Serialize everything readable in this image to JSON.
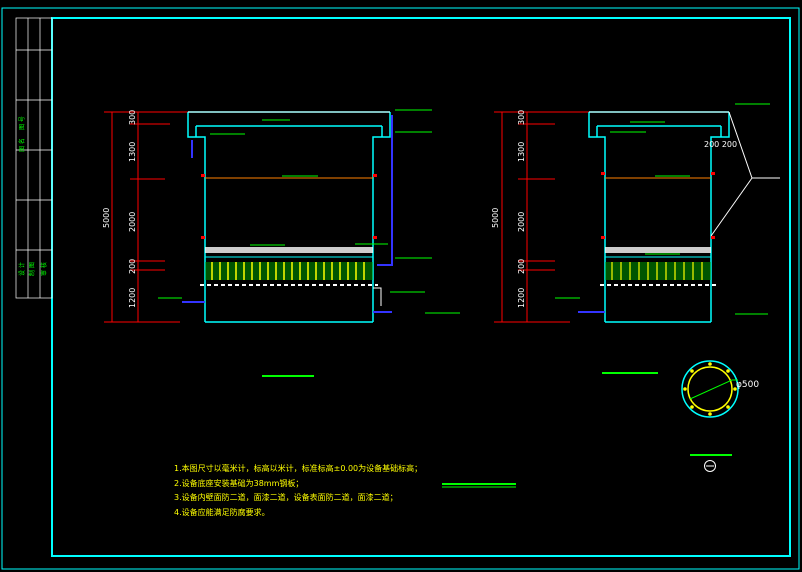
{
  "drawing": {
    "left_elevation": {
      "dims": [
        "300",
        "1300",
        "2000",
        "200",
        "1200"
      ],
      "total": "5000"
    },
    "right_elevation": {
      "dims": [
        "300",
        "1300",
        "2000",
        "200",
        "1200"
      ],
      "total": "5000",
      "callout": "200 200"
    },
    "plan_diameter": "φ500",
    "notes": [
      "1.本图尺寸以毫米计，标高以米计，标准标高±0.00为设备基础标高；",
      "2.设备底座安装基础为38mm钢板；",
      "3.设备内壁面防二道，面漆二道，设备表面防二道，面漆二道；",
      "4.设备应能满足防腐要求。"
    ],
    "title_block_labels": [
      "图 号",
      "图 名",
      "设 计",
      "制 图",
      "审 核"
    ]
  },
  "colors": {
    "frame": "#00ffff",
    "tank": "#00ffff",
    "dims": "#ff0000",
    "levels": "#00ff00",
    "notes": "#ffff00",
    "pipes": "#3333ff",
    "orange": "#ff8000"
  }
}
